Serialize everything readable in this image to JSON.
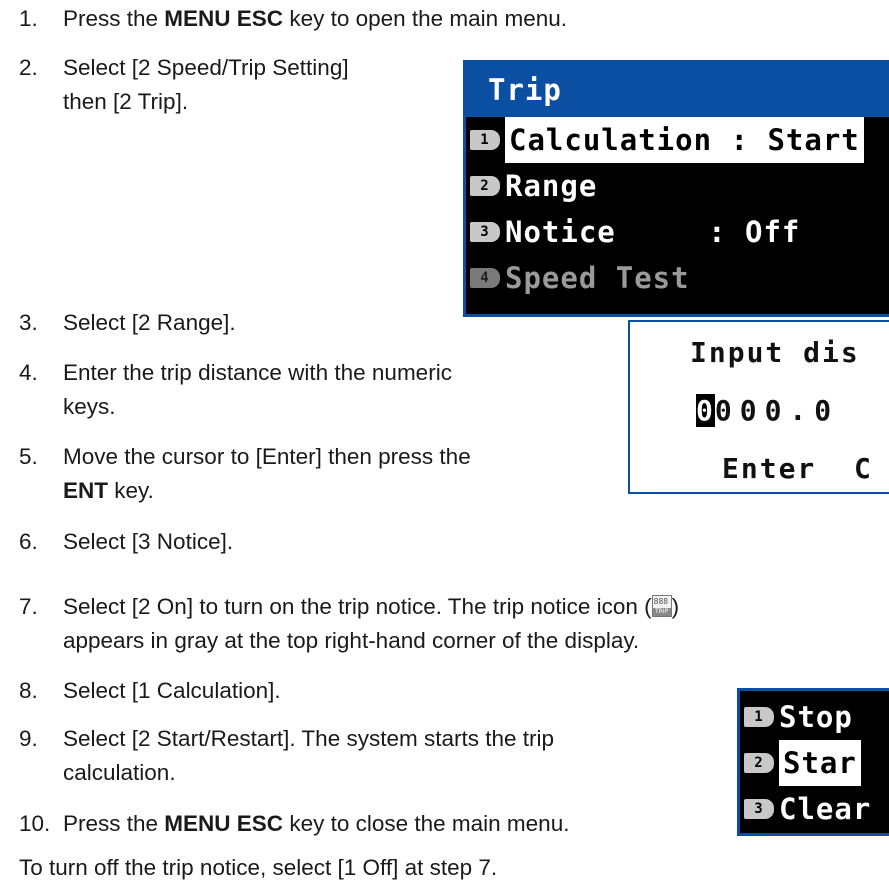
{
  "steps": [
    {
      "num": "1.",
      "pre": "Press the ",
      "bold": "MENU ESC",
      "post": " key to open the main menu."
    },
    {
      "num": "2.",
      "line1": "Select [2 Speed/Trip Setting]",
      "line2": "then [2 Trip]."
    },
    {
      "num": "3.",
      "text": "Select [2 Range]."
    },
    {
      "num": "4.",
      "line1": "Enter the trip distance with the numeric",
      "line2": "keys."
    },
    {
      "num": "5.",
      "line1": "Move the cursor to [Enter] then press the",
      "line2_bold": "ENT",
      "line2_post": " key."
    },
    {
      "num": "6.",
      "text": "Select [3 Notice]."
    },
    {
      "num": "7.",
      "line1_pre": "Select [2 On] to turn on the trip notice. The trip notice icon (",
      "line1_post": ")",
      "line2": "appears in gray at the top right-hand corner of the display."
    },
    {
      "num": "8.",
      "text": "Select [1 Calculation]."
    },
    {
      "num": "9.",
      "line1": "Select [2 Start/Restart]. The system starts the trip",
      "line2": "calculation."
    },
    {
      "num": "10.",
      "pre": "Press the ",
      "bold": "MENU ESC",
      "post": " key to close the main menu."
    }
  ],
  "footer": "To turn off the trip notice, select [1 Off] at step 7.",
  "trip_icon": {
    "digits": "888",
    "label": "TRIP"
  },
  "trip_menu": {
    "title": "Trip",
    "items": [
      {
        "key": "1",
        "label": "Calculation",
        "sep": " : ",
        "value": "Start"
      },
      {
        "key": "2",
        "label": "Range"
      },
      {
        "key": "3",
        "label": "Notice",
        "sep": "     : ",
        "value": "Off"
      },
      {
        "key": "4",
        "label": "Speed Test"
      }
    ]
  },
  "input_dialog": {
    "prompt": "Input dis",
    "cursor_digit": "0",
    "value_rest": "000.0",
    "buttons": "Enter  C"
  },
  "calc_menu": {
    "items": [
      {
        "key": "1",
        "label": "Stop"
      },
      {
        "key": "2",
        "label": "Star"
      },
      {
        "key": "3",
        "label": "Clear"
      }
    ]
  }
}
